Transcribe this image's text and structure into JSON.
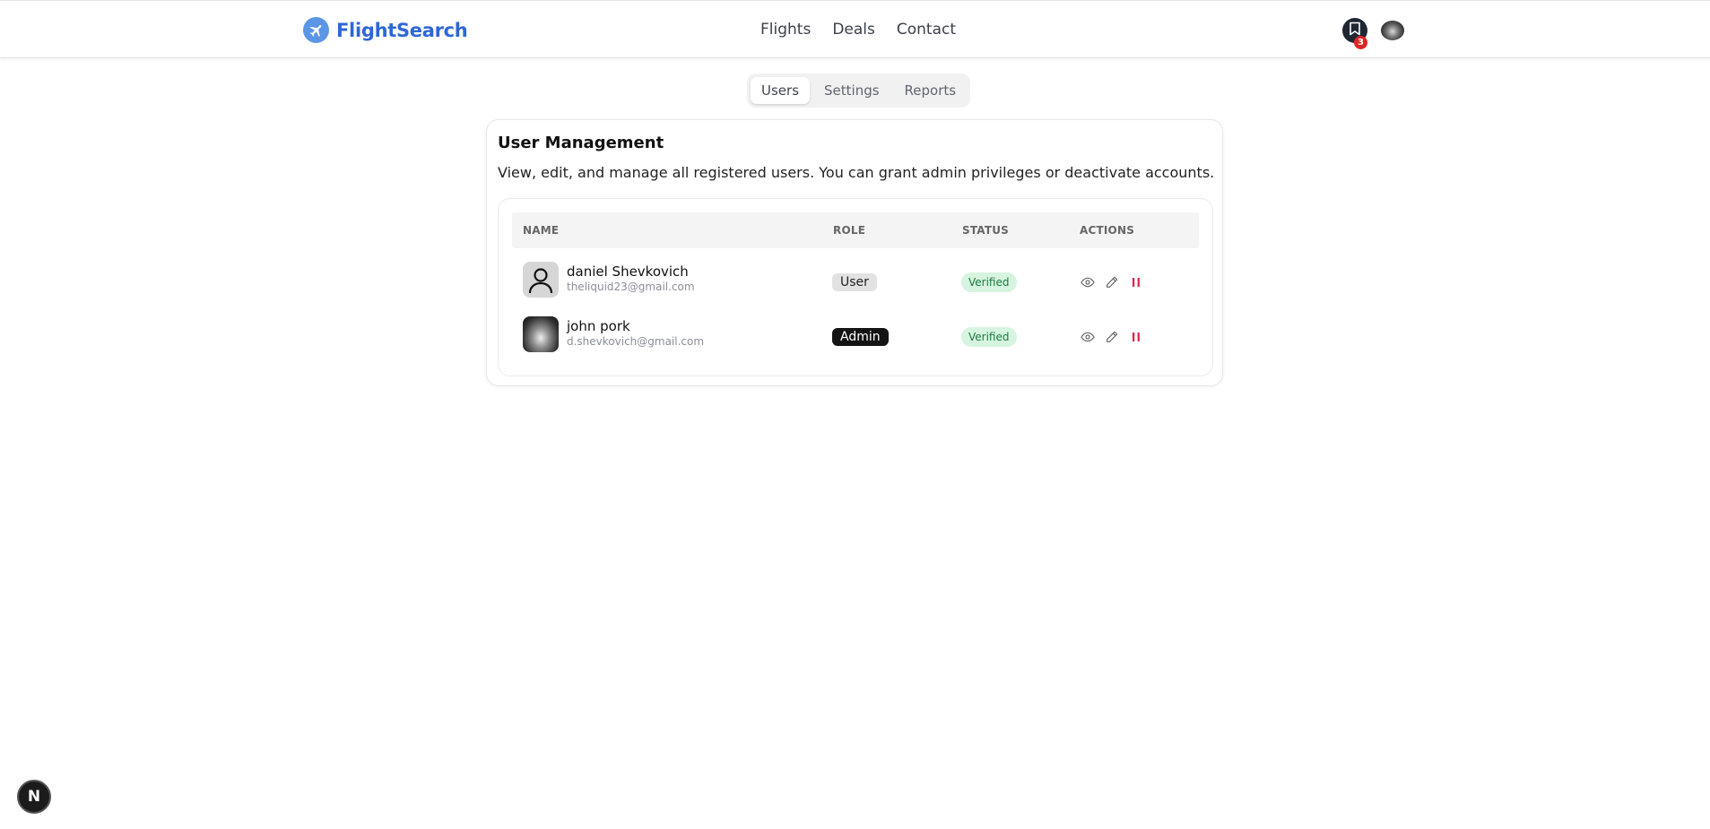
{
  "header": {
    "brand": "FlightSearch",
    "nav": [
      "Flights",
      "Deals",
      "Contact"
    ],
    "bookmark_count": "3"
  },
  "tabs": [
    {
      "label": "Users",
      "active": true
    },
    {
      "label": "Settings",
      "active": false
    },
    {
      "label": "Reports",
      "active": false
    }
  ],
  "card": {
    "title": "User Management",
    "description": "View, edit, and manage all registered users. You can grant admin privileges or deactivate accounts."
  },
  "table": {
    "headers": [
      "NAME",
      "ROLE",
      "STATUS",
      "ACTIONS"
    ],
    "rows": [
      {
        "name": "daniel Shevkovich",
        "email": "theliquid23@gmail.com",
        "role": "User",
        "status": "Verified",
        "avatar": "default-user-icon"
      },
      {
        "name": "john pork",
        "email": "d.shevkovich@gmail.com",
        "role": "Admin",
        "status": "Verified",
        "avatar": "profile-photo"
      }
    ]
  },
  "corner_badge": "N",
  "colors": {
    "brand": "#2e67d6",
    "pause": "#e11d48",
    "verified_bg": "#d6f4df",
    "verified_text": "#1e7a41"
  }
}
